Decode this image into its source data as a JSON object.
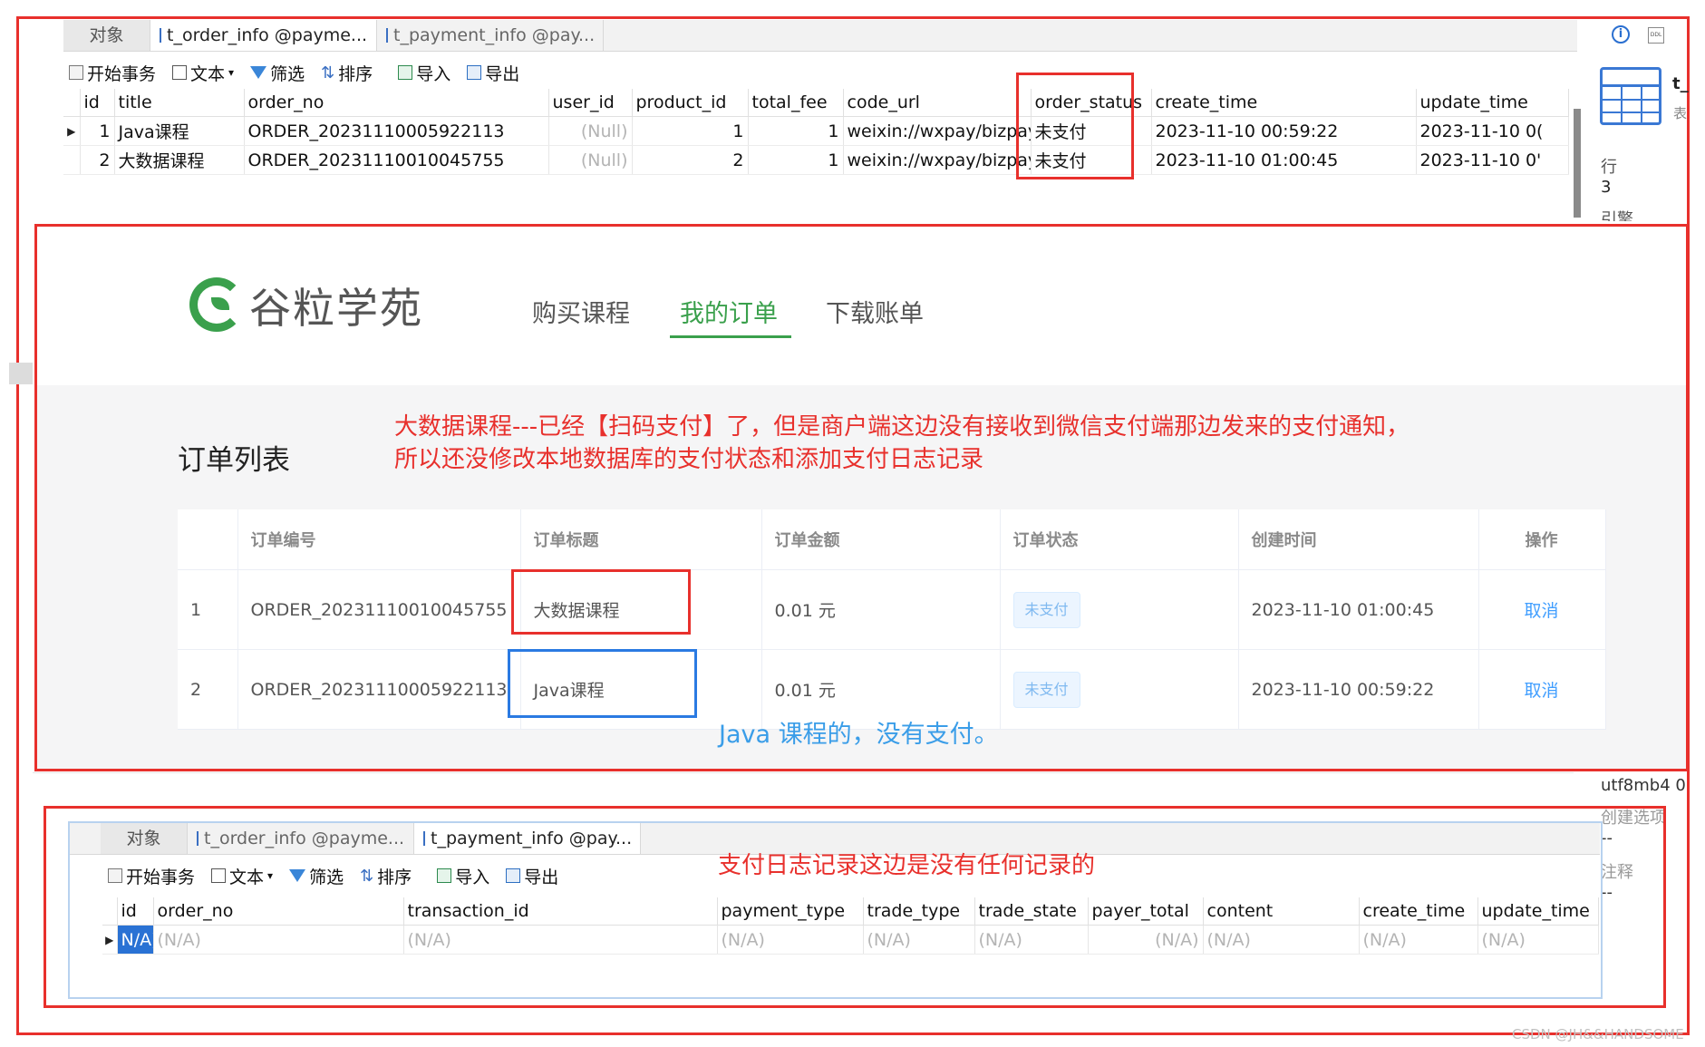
{
  "top_grid": {
    "tabs": [
      {
        "label": "对象"
      },
      {
        "label": "t_order_info @payme..."
      },
      {
        "label": "t_payment_info @pay..."
      }
    ],
    "toolbar": {
      "begin_transaction": "开始事务",
      "text": "文本",
      "filter": "筛选",
      "sort": "排序",
      "import": "导入",
      "export": "导出"
    },
    "columns": [
      "id",
      "title",
      "order_no",
      "user_id",
      "product_id",
      "total_fee",
      "code_url",
      "order_status",
      "create_time",
      "update_time"
    ],
    "rows": [
      {
        "id": "1",
        "title": "Java课程",
        "order_no": "ORDER_20231110005922113",
        "user_id": "(Null)",
        "product_id": "1",
        "total_fee": "1",
        "code_url": "weixin://wxpay/bizpay",
        "order_status": "未支付",
        "create_time": "2023-11-10 00:59:22",
        "update_time": "2023-11-10 0("
      },
      {
        "id": "2",
        "title": "大数据课程",
        "order_no": "ORDER_20231110010045755",
        "user_id": "(Null)",
        "product_id": "2",
        "total_fee": "1",
        "code_url": "weixin://wxpay/bizpay",
        "order_status": "未支付",
        "create_time": "2023-11-10 01:00:45",
        "update_time": "2023-11-10 0'"
      }
    ]
  },
  "right_panel": {
    "title_fragment": "t_",
    "subtitle_fragment": "表",
    "rows_label": "行",
    "rows_value": "3",
    "engine_label": "引擎",
    "charset": "utf8mb4 0",
    "create_options": "创建选项",
    "dash1": "--",
    "comment": "注释",
    "dash2": "--"
  },
  "web": {
    "logo_text": "谷粒学苑",
    "nav": [
      {
        "label": "购买课程"
      },
      {
        "label": "我的订单"
      },
      {
        "label": "下载账单"
      }
    ],
    "section_title": "订单列表",
    "note_red_line1": "大数据课程---已经【扫码支付】了，但是商户端这边没有接收到微信支付端那边发来的支付通知，",
    "note_red_line2": "所以还没修改本地数据库的支付状态和添加支付日志记录",
    "table_headers": [
      "",
      "订单编号",
      "订单标题",
      "订单金额",
      "订单状态",
      "创建时间",
      "操作"
    ],
    "orders": [
      {
        "index": "1",
        "order_no": "ORDER_20231110010045755",
        "title": "大数据课程",
        "amount": "0.01 元",
        "status": "未支付",
        "created": "2023-11-10 01:00:45",
        "action": "取消"
      },
      {
        "index": "2",
        "order_no": "ORDER_20231110005922113",
        "title": "Java课程",
        "amount": "0.01 元",
        "status": "未支付",
        "created": "2023-11-10 00:59:22",
        "action": "取消"
      }
    ],
    "note_blue": "Java 课程的，没有支付。",
    "colors": {
      "brand_green": "#3aa04c",
      "annotation_red": "#e8302c",
      "annotation_blue": "#2a7ae2",
      "link_blue": "#409eff"
    }
  },
  "bottom_grid": {
    "tabs": [
      {
        "label": "对象"
      },
      {
        "label": "t_order_info @payme..."
      },
      {
        "label": "t_payment_info @pay..."
      }
    ],
    "toolbar": {
      "begin_transaction": "开始事务",
      "text": "文本",
      "filter": "筛选",
      "sort": "排序",
      "import": "导入",
      "export": "导出"
    },
    "note_red": "支付日志记录这边是没有任何记录的",
    "columns": [
      "id",
      "order_no",
      "transaction_id",
      "payment_type",
      "trade_type",
      "trade_state",
      "payer_total",
      "content",
      "create_time",
      "update_time"
    ],
    "row": [
      "N/A)",
      "(N/A)",
      "(N/A)",
      "(N/A)",
      "(N/A)",
      "(N/A)",
      "(N/A)",
      "(N/A)",
      "(N/A)",
      "(N/A)"
    ]
  },
  "watermark": "CSDN @JH&&HANDSOME"
}
